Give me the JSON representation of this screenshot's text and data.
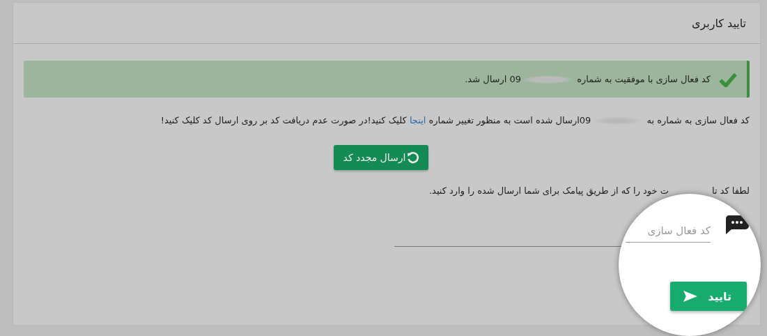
{
  "card": {
    "title": "تایید کاربری"
  },
  "alert": {
    "kind": "success",
    "text_before": "کد فعال سازی با موفقیت به شماره ",
    "number_visible": "09",
    "text_after": " ارسال شد."
  },
  "info": {
    "before": "کد فعال سازی به شماره به ",
    "number_visible": "09",
    "middle": "ارسال شده است به منظور تغییر شماره ",
    "link": "اینجا",
    "after": " کلیک کنید!در صورت عدم دریافت کد بر روی ارسال کد کلیک کنید!"
  },
  "resend_button": {
    "label": "ارسال مجدد کد"
  },
  "instruction": {
    "start": "لطفا کد تا",
    "end": "ت خود را که از طریق پیامک برای شما ارسال شده را وارد کنید."
  },
  "magnifier": {
    "field": {
      "placeholder": "کد فعال سازی"
    },
    "button": {
      "label": "تایید"
    }
  }
}
